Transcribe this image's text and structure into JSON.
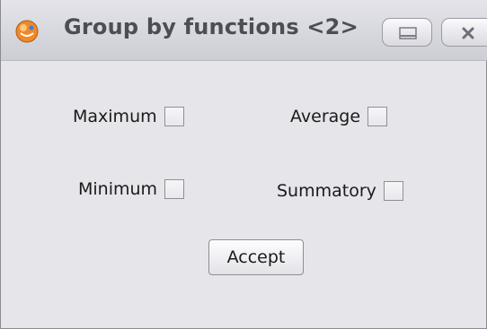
{
  "window": {
    "title": "Group by functions <2>",
    "controls": {
      "minimize_icon": "minimize-icon",
      "close_icon": "close-icon"
    }
  },
  "options": {
    "maximum": {
      "label": "Maximum",
      "checked": false
    },
    "average": {
      "label": "Average",
      "checked": false
    },
    "minimum": {
      "label": "Minimum",
      "checked": false
    },
    "summatory": {
      "label": "Summatory",
      "checked": false
    }
  },
  "actions": {
    "accept_label": "Accept"
  },
  "colors": {
    "background": "#e6e5ea",
    "titlebar": "#d7d7de",
    "title_text": "#4d4d55",
    "app_icon": "#f0892a"
  }
}
